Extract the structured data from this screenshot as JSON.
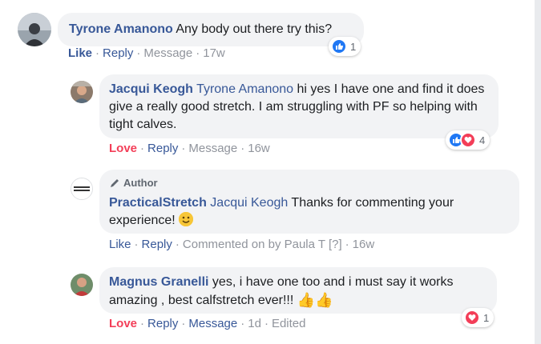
{
  "comments": [
    {
      "author": "Tyrone Amanono",
      "text": "Any body out there try this?",
      "actions": {
        "like": "Like",
        "reply": "Reply",
        "message": "Message",
        "time": "17w"
      },
      "reactions": {
        "count": "1"
      }
    },
    {
      "author": "Jacqui Keogh",
      "mention": "Tyrone Amanono",
      "text": "hi yes I have one and find it does give a really good stretch. I am struggling with PF so helping with tight calves.",
      "actions": {
        "love": "Love",
        "reply": "Reply",
        "message": "Message",
        "time": "16w"
      },
      "reactions": {
        "count": "4"
      }
    },
    {
      "badge": "Author",
      "author": "PracticalStretch",
      "mention": "Jacqui Keogh",
      "text": "Thanks for commenting your experience!",
      "actions": {
        "like": "Like",
        "reply": "Reply",
        "commented_by": "Commented on by Paula T",
        "help": "[?]",
        "time": "16w"
      }
    },
    {
      "author": "Magnus Granelli",
      "text": "yes, i have one too and i must say it works amazing , best calfstretch ever!!!",
      "actions": {
        "love": "Love",
        "reply": "Reply",
        "message": "Message",
        "time": "1d",
        "edited": "Edited"
      },
      "reactions": {
        "count": "1"
      }
    }
  ],
  "colors": {
    "link": "#385898",
    "love": "#f33e58",
    "like": "#2078f4",
    "bubble": "#f2f3f5",
    "muted": "#90949c"
  },
  "icons": [
    "like-icon",
    "love-icon",
    "pencil-icon",
    "smile-emoji",
    "thumbs-up-emoji"
  ]
}
